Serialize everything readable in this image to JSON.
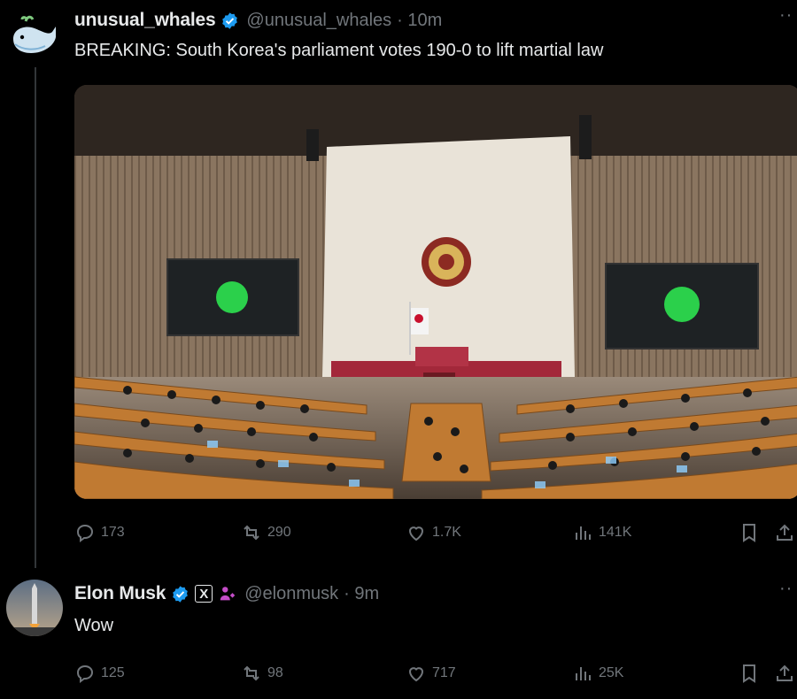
{
  "tweets": [
    {
      "name": "unusual_whales",
      "handle": "@unusual_whales",
      "time": "· 10m",
      "text": "BREAKING: South Korea's parliament votes 190-0 to lift martial law",
      "stats": {
        "replies": "173",
        "reposts": "290",
        "likes": "1.7K",
        "views": "141K"
      }
    },
    {
      "name": "Elon Musk",
      "handle": "@elonmusk",
      "time": "· 9m",
      "text": "Wow",
      "stats": {
        "replies": "125",
        "reposts": "98",
        "likes": "717",
        "views": "25K"
      }
    }
  ],
  "colors": {
    "background": "#000000",
    "text": "#e7e9ea",
    "muted": "#71767b",
    "verified": "#1d9bf0",
    "x_badge_border": "#e7e9ea",
    "affiliate_icon": "#c44dc8"
  },
  "icons": [
    "reply-icon",
    "repost-icon",
    "like-icon",
    "views-icon",
    "bookmark-icon",
    "share-icon",
    "verified-icon",
    "more-icon"
  ]
}
